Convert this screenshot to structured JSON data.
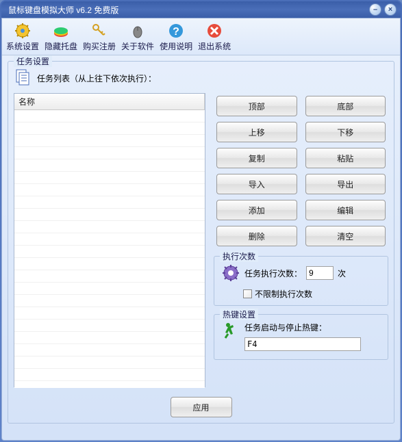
{
  "window": {
    "title": "鼠标键盘模拟大师 v6.2 免费版"
  },
  "toolbar": [
    {
      "label": "系统设置",
      "name": "system-settings"
    },
    {
      "label": "隐藏托盘",
      "name": "hide-tray"
    },
    {
      "label": "购买注册",
      "name": "buy-register"
    },
    {
      "label": "关于软件",
      "name": "about"
    },
    {
      "label": "使用说明",
      "name": "help"
    },
    {
      "label": "退出系统",
      "name": "exit"
    }
  ],
  "task_group_title": "任务设置",
  "task_list_label": "任务列表（从上往下依次执行）：",
  "list_header": "名称",
  "buttons": {
    "top": "顶部",
    "bottom": "底部",
    "up": "上移",
    "down": "下移",
    "copy": "复制",
    "paste": "粘贴",
    "import": "导入",
    "export": "导出",
    "add": "添加",
    "edit": "编辑",
    "delete": "删除",
    "clear": "清空"
  },
  "exec_group_title": "执行次数",
  "exec_label": "任务执行次数：",
  "exec_value": "9",
  "exec_unit": "次",
  "unlimited_label": "不限制执行次数",
  "hotkey_group_title": "热键设置",
  "hotkey_label": "任务启动与停止热键：",
  "hotkey_value": "F4",
  "apply_label": "应用"
}
